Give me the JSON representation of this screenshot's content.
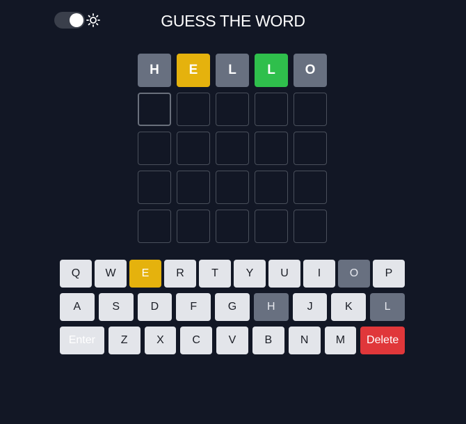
{
  "header": {
    "title": "GUESS THE WORD",
    "theme_toggle_on": true
  },
  "board": {
    "rows": [
      [
        {
          "letter": "H",
          "state": "absent"
        },
        {
          "letter": "E",
          "state": "present"
        },
        {
          "letter": "L",
          "state": "absent"
        },
        {
          "letter": "L",
          "state": "correct"
        },
        {
          "letter": "O",
          "state": "absent"
        }
      ],
      [
        {
          "letter": "",
          "state": "active"
        },
        {
          "letter": "",
          "state": "empty"
        },
        {
          "letter": "",
          "state": "empty"
        },
        {
          "letter": "",
          "state": "empty"
        },
        {
          "letter": "",
          "state": "empty"
        }
      ],
      [
        {
          "letter": "",
          "state": "empty"
        },
        {
          "letter": "",
          "state": "empty"
        },
        {
          "letter": "",
          "state": "empty"
        },
        {
          "letter": "",
          "state": "empty"
        },
        {
          "letter": "",
          "state": "empty"
        }
      ],
      [
        {
          "letter": "",
          "state": "empty"
        },
        {
          "letter": "",
          "state": "empty"
        },
        {
          "letter": "",
          "state": "empty"
        },
        {
          "letter": "",
          "state": "empty"
        },
        {
          "letter": "",
          "state": "empty"
        }
      ],
      [
        {
          "letter": "",
          "state": "empty"
        },
        {
          "letter": "",
          "state": "empty"
        },
        {
          "letter": "",
          "state": "empty"
        },
        {
          "letter": "",
          "state": "empty"
        },
        {
          "letter": "",
          "state": "empty"
        }
      ]
    ]
  },
  "keyboard": {
    "row1": [
      {
        "label": "Q",
        "state": ""
      },
      {
        "label": "W",
        "state": ""
      },
      {
        "label": "E",
        "state": "present"
      },
      {
        "label": "R",
        "state": ""
      },
      {
        "label": "T",
        "state": ""
      },
      {
        "label": "Y",
        "state": ""
      },
      {
        "label": "U",
        "state": ""
      },
      {
        "label": "I",
        "state": ""
      },
      {
        "label": "O",
        "state": "absent"
      },
      {
        "label": "P",
        "state": ""
      }
    ],
    "row2": [
      {
        "label": "A",
        "state": ""
      },
      {
        "label": "S",
        "state": ""
      },
      {
        "label": "D",
        "state": ""
      },
      {
        "label": "F",
        "state": ""
      },
      {
        "label": "G",
        "state": ""
      },
      {
        "label": "H",
        "state": "absent"
      },
      {
        "label": "J",
        "state": ""
      },
      {
        "label": "K",
        "state": ""
      },
      {
        "label": "L",
        "state": "absent"
      }
    ],
    "row3": [
      {
        "label": "Enter",
        "state": "enter"
      },
      {
        "label": "Z",
        "state": ""
      },
      {
        "label": "X",
        "state": ""
      },
      {
        "label": "C",
        "state": ""
      },
      {
        "label": "V",
        "state": ""
      },
      {
        "label": "B",
        "state": ""
      },
      {
        "label": "N",
        "state": ""
      },
      {
        "label": "M",
        "state": ""
      },
      {
        "label": "Delete",
        "state": "delete"
      }
    ]
  },
  "colors": {
    "background": "#121725",
    "absent": "#687080",
    "present": "#e5b20d",
    "correct": "#2fbf4c",
    "delete": "#e0373a"
  }
}
